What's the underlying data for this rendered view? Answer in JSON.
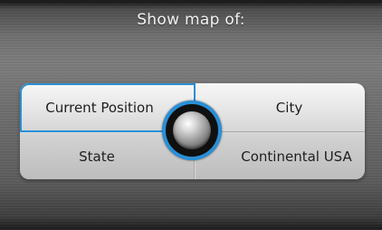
{
  "header": {
    "title": "Show map of:"
  },
  "options": {
    "current_position": "Current Position",
    "city": "City",
    "state": "State",
    "continental_usa": "Continental USA"
  },
  "selected": "current_position",
  "colors": {
    "highlight": "#2a8fd6",
    "panel": "#d6d6d6",
    "background": "#6e6e6e"
  }
}
